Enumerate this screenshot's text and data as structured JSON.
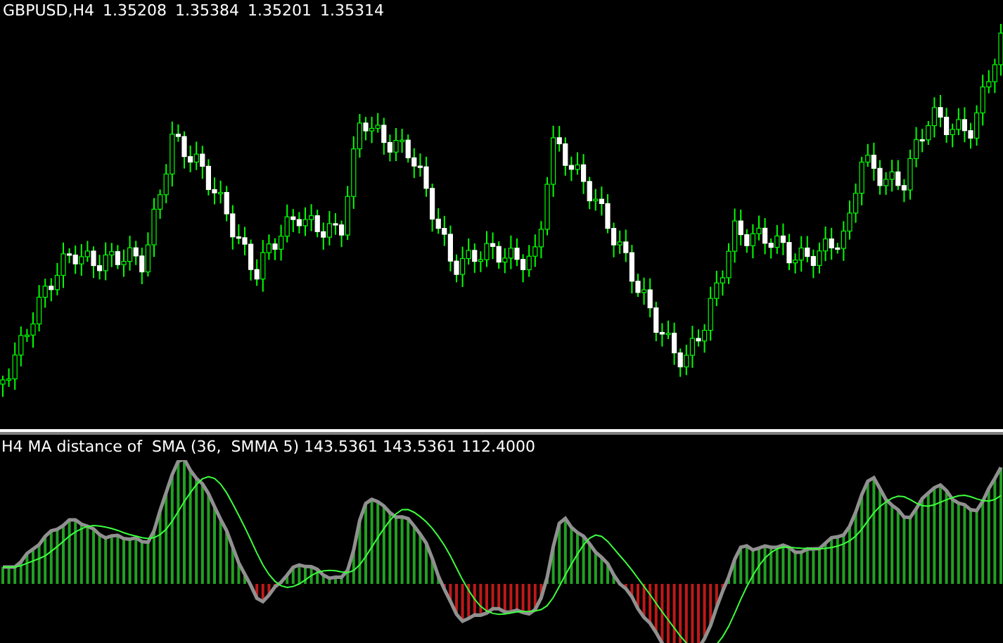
{
  "main_chart": {
    "symbol": "GBPUSD,H4",
    "quotes": [
      "1.35208",
      "1.35384",
      "1.35201",
      "1.35314"
    ]
  },
  "indicator": {
    "label": "H4 MA distance of  SMA (36,  SMMA 5) 143.5361 143.5361 112.4000"
  }
}
